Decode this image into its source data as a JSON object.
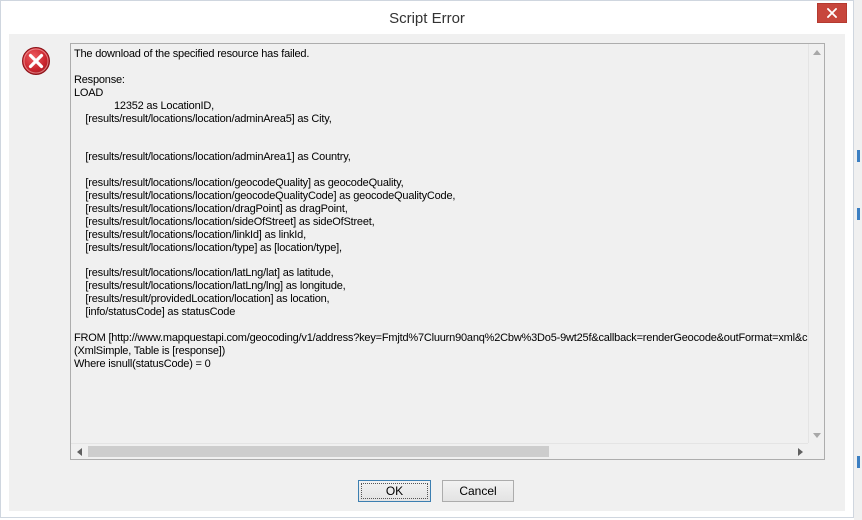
{
  "window": {
    "title": "Script Error"
  },
  "message": {
    "text": "The download of the specified resource has failed.\n\nResponse:\nLOAD\n              12352 as LocationID,\n    [results/result/locations/location/adminArea5] as City,\n\n\n    [results/result/locations/location/adminArea1] as Country,\n\n    [results/result/locations/location/geocodeQuality] as geocodeQuality,\n    [results/result/locations/location/geocodeQualityCode] as geocodeQualityCode,\n    [results/result/locations/location/dragPoint] as dragPoint,\n    [results/result/locations/location/sideOfStreet] as sideOfStreet,\n    [results/result/locations/location/linkId] as linkId,\n    [results/result/locations/location/type] as [location/type],\n\n    [results/result/locations/location/latLng/lat] as latitude,\n    [results/result/locations/location/latLng/lng] as longitude,\n    [results/result/providedLocation/location] as location,\n    [info/statusCode] as statusCode\n\nFROM [http://www.mapquestapi.com/geocoding/v1/address?key=Fmjtd%7Cluurn90anq%2Cbw%3Do5-9wt25f&callback=renderGeocode&outFormat=xml&city\n(XmlSimple, Table is [response])\nWhere isnull(statusCode) = 0"
  },
  "buttons": {
    "ok_label": "OK",
    "cancel_label": "Cancel"
  },
  "colors": {
    "close_button": "#c7463c",
    "error_icon": "#c8232c",
    "dialog_background": "#f0f0f0",
    "focus_border": "#3c7fb1"
  },
  "icons": {
    "close": "close-icon",
    "error": "error-icon",
    "scroll_up": "chevron-up-icon",
    "scroll_down": "chevron-down-icon",
    "scroll_left": "chevron-left-icon",
    "scroll_right": "chevron-right-icon"
  }
}
